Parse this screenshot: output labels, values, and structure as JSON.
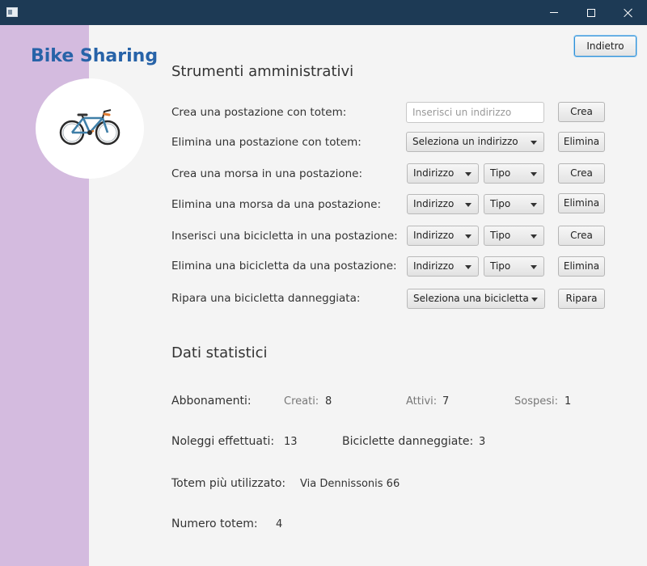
{
  "window": {
    "app_icon": "window-app-icon",
    "controls": [
      "minimize-icon",
      "maximize-icon",
      "close-icon"
    ]
  },
  "sidebar": {
    "brand": "Bike Sharing",
    "logo_icon": "bicycle-icon"
  },
  "header": {
    "back_label": "Indietro"
  },
  "admin": {
    "title": "Strumenti amministrativi",
    "rows": [
      {
        "label": "Crea una postazione con totem:",
        "input_placeholder": "Inserisci un indirizzo",
        "button": "Crea"
      },
      {
        "label": "Elimina una postazione con totem:",
        "select": "Seleziona un indirizzo",
        "button": "Elimina"
      },
      {
        "label": "Crea una morsa in una postazione:",
        "select_address": "Indirizzo",
        "select_type": "Tipo",
        "button": "Crea"
      },
      {
        "label": "Elimina una morsa da una postazione:",
        "select_address": "Indirizzo",
        "select_type": "Tipo",
        "button": "Elimina"
      },
      {
        "label": "Inserisci una bicicletta in una postazione:",
        "select_address": "Indirizzo",
        "select_type": "Tipo",
        "button": "Crea"
      },
      {
        "label": "Elimina una bicicletta da una postazione:",
        "select_address": "Indirizzo",
        "select_type": "Tipo",
        "button": "Elimina"
      },
      {
        "label": "Ripara una bicicletta danneggiata:",
        "select": "Seleziona una bicicletta",
        "button": "Ripara"
      }
    ]
  },
  "stats": {
    "title": "Dati statistici",
    "subscriptions": {
      "label": "Abbonamenti:",
      "created_label": "Creati:",
      "created_value": "8",
      "active_label": "Attivi:",
      "active_value": "7",
      "suspended_label": "Sospesi:",
      "suspended_value": "1"
    },
    "rentals": {
      "label": "Noleggi effettuati:",
      "value": "13"
    },
    "damaged": {
      "label": "Biciclette danneggiate:",
      "value": "3"
    },
    "top_totem": {
      "label": "Totem più utilizzato:",
      "value": "Via Dennissonis 66"
    },
    "totem_count": {
      "label": "Numero totem:",
      "value": "4"
    }
  }
}
